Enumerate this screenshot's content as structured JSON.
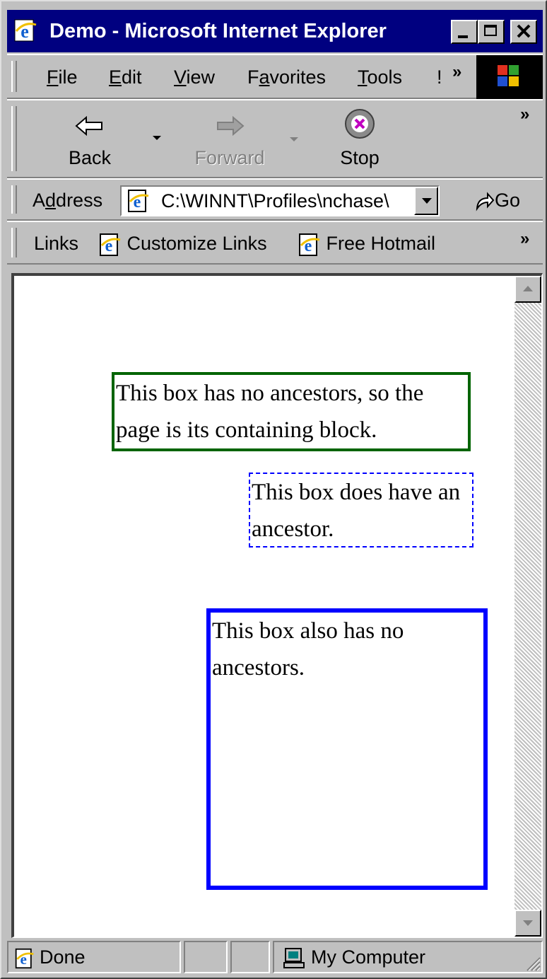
{
  "window": {
    "title": "Demo - Microsoft Internet Explorer"
  },
  "menu": {
    "items": [
      {
        "label": "File",
        "mnemonic": "F"
      },
      {
        "label": "Edit",
        "mnemonic": "E"
      },
      {
        "label": "View",
        "mnemonic": "V"
      },
      {
        "label": "Favorites",
        "mnemonic": "a"
      },
      {
        "label": "Tools",
        "mnemonic": "T"
      },
      {
        "label": "!"
      }
    ]
  },
  "toolbar": {
    "back_label": "Back",
    "forward_label": "Forward",
    "stop_label": "Stop"
  },
  "address": {
    "label": "Address",
    "value": "C:\\WINNT\\Profiles\\nchase\\",
    "go_label": "Go"
  },
  "links": {
    "label": "Links",
    "items": [
      "Customize Links",
      "Free Hotmail"
    ]
  },
  "page": {
    "box1_text": "This box has no ancestors, so the page is its containing block.",
    "box2_text": "This box does have an ancestor.",
    "box3_text": "This box also has no ancestors.",
    "box1_border_color": "#006400",
    "box2_border_color": "#0000ff",
    "box3_border_color": "#0000ff"
  },
  "status": {
    "text": "Done",
    "zone": "My Computer"
  },
  "colors": {
    "titlebar": "#000080",
    "chrome": "#c0c0c0"
  }
}
